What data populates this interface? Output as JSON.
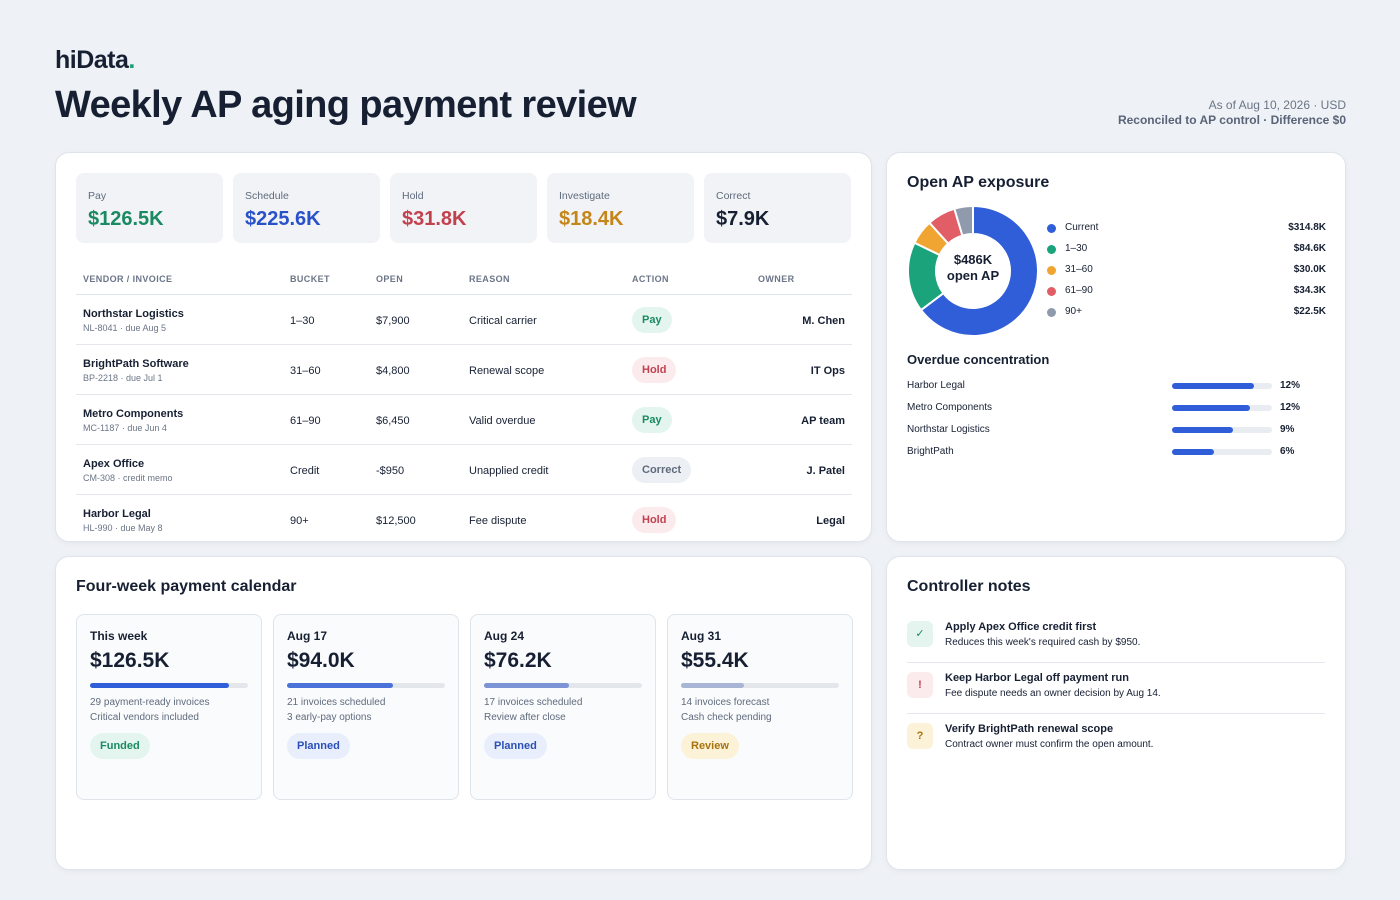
{
  "brand": {
    "name": "hiData",
    "dot": "."
  },
  "page": {
    "title": "Weekly AP aging payment review",
    "as_of": "As of Aug 10, 2026 · USD",
    "reconciled": "Reconciled to AP control · Difference $0"
  },
  "kpis": [
    {
      "label": "Pay",
      "value": "$126.5K",
      "color": "#1a8a62"
    },
    {
      "label": "Schedule",
      "value": "$225.6K",
      "color": "#2a52c8"
    },
    {
      "label": "Hold",
      "value": "$31.8K",
      "color": "#c2414f"
    },
    {
      "label": "Investigate",
      "value": "$18.4K",
      "color": "#c4851a"
    },
    {
      "label": "Correct",
      "value": "$7.9K",
      "color": "#172033"
    }
  ],
  "table": {
    "headers": {
      "vendor": "VENDOR / INVOICE",
      "bucket": "BUCKET",
      "open": "OPEN",
      "reason": "REASON",
      "action": "ACTION",
      "owner": "OWNER"
    },
    "rows": [
      {
        "vendor": "Northstar Logistics",
        "invoice": "NL-8041 · due Aug 5",
        "bucket": "1–30",
        "open": "$7,900",
        "reason": "Critical carrier",
        "action": "Pay",
        "owner": "M. Chen"
      },
      {
        "vendor": "BrightPath Software",
        "invoice": "BP-2218 · due Jul 1",
        "bucket": "31–60",
        "open": "$4,800",
        "reason": "Renewal scope",
        "action": "Hold",
        "owner": "IT Ops"
      },
      {
        "vendor": "Metro Components",
        "invoice": "MC-1187 · due Jun 4",
        "bucket": "61–90",
        "open": "$6,450",
        "reason": "Valid overdue",
        "action": "Pay",
        "owner": "AP team"
      },
      {
        "vendor": "Apex Office",
        "invoice": "CM-308 · credit memo",
        "bucket": "Credit",
        "open": "-$950",
        "reason": "Unapplied credit",
        "action": "Correct",
        "owner": "J. Patel"
      },
      {
        "vendor": "Harbor Legal",
        "invoice": "HL-990 · due May 8",
        "bucket": "90+",
        "open": "$12,500",
        "reason": "Fee dispute",
        "action": "Hold",
        "owner": "Legal"
      }
    ]
  },
  "exposure": {
    "title": "Open AP exposure",
    "center_value": "$486K",
    "center_label": "open AP",
    "legend": [
      {
        "name": "Current",
        "value": "$314.8K",
        "color": "#2f5ed8"
      },
      {
        "name": "1–30",
        "value": "$84.6K",
        "color": "#1ba37b"
      },
      {
        "name": "31–60",
        "value": "$30.0K",
        "color": "#f0a532"
      },
      {
        "name": "61–90",
        "value": "$34.3K",
        "color": "#e25e66"
      },
      {
        "name": "90+",
        "value": "$22.5K",
        "color": "#8f9bad"
      }
    ],
    "chart_data": {
      "type": "pie",
      "categories": [
        "Current",
        "1–30",
        "31–60",
        "61–90",
        "90+"
      ],
      "values": [
        314.8,
        84.6,
        30.0,
        34.3,
        22.5
      ],
      "unit": "$K"
    },
    "concentration_title": "Overdue concentration",
    "concentration": [
      {
        "name": "Harbor Legal",
        "pct": "12%",
        "fill": 0.82
      },
      {
        "name": "Metro Components",
        "pct": "12%",
        "fill": 0.78
      },
      {
        "name": "Northstar Logistics",
        "pct": "9%",
        "fill": 0.61
      },
      {
        "name": "BrightPath",
        "pct": "6%",
        "fill": 0.42
      }
    ]
  },
  "calendar": {
    "title": "Four-week payment calendar",
    "weeks": [
      {
        "label": "This week",
        "value": "$126.5K",
        "line1": "29 payment-ready invoices",
        "line2": "Critical vendors included",
        "status": "Funded",
        "progress": 0.88,
        "bar_color": "#2f5ed8"
      },
      {
        "label": "Aug 17",
        "value": "$94.0K",
        "line1": "21 invoices scheduled",
        "line2": "3 early-pay options",
        "status": "Planned",
        "progress": 0.67,
        "bar_color": "#4a72d9"
      },
      {
        "label": "Aug 24",
        "value": "$76.2K",
        "line1": "17 invoices scheduled",
        "line2": "Review after close",
        "status": "Planned",
        "progress": 0.54,
        "bar_color": "#7d94d4"
      },
      {
        "label": "Aug 31",
        "value": "$55.4K",
        "line1": "14 invoices forecast",
        "line2": "Cash check pending",
        "status": "Review",
        "progress": 0.4,
        "bar_color": "#a8b5d4"
      }
    ]
  },
  "notes": {
    "title": "Controller notes",
    "items": [
      {
        "icon": "✓",
        "kind": "ok",
        "title": "Apply Apex Office credit first",
        "sub": "Reduces this week's required cash by $950."
      },
      {
        "icon": "!",
        "kind": "warn",
        "title": "Keep Harbor Legal off payment run",
        "sub": "Fee dispute needs an owner decision by Aug 14."
      },
      {
        "icon": "?",
        "kind": "q",
        "title": "Verify BrightPath renewal scope",
        "sub": "Contract owner must confirm the open amount."
      }
    ]
  }
}
